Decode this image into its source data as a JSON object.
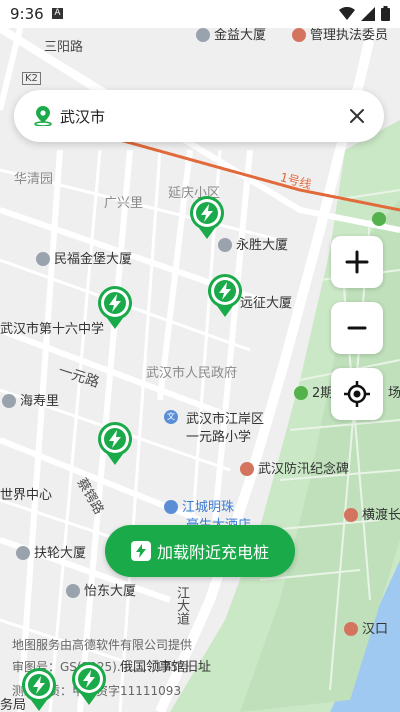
{
  "status_bar": {
    "time": "9:36",
    "notification_glyph": "A"
  },
  "search": {
    "city": "武汉市"
  },
  "map_controls": {
    "zoom_in": "+",
    "zoom_out": "−"
  },
  "load_button": {
    "label": "加载附近充电桩"
  },
  "map_labels": {
    "sanyang_road": "三阳路",
    "jinyi_building": "金益大厦",
    "admin_office": "管理执法委员",
    "k2": "K2",
    "huaqingyuan": "华清园",
    "guangxingli": "广兴里",
    "yanqing_area": "延庆小区",
    "line1": "1号线",
    "minfu_building": "民福金堡大厦",
    "yongsheng_building": "永胜大厦",
    "yuanzheng_building": "远征大厦",
    "school16": "武汉市第十六中学",
    "yiyuan_road": "一元路",
    "gov": "武汉市人民政府",
    "haishouli": "海寿里",
    "jiangan_school_1": "武汉市江岸区",
    "jiangan_school_2": "一元路小学",
    "flood_memorial": "武汉防汛纪念碑",
    "world_center": "世界中心",
    "caie_road": "蔡锷路",
    "jiangcheng_hotel_1": "江城明珠",
    "jiangcheng_hotel_2": "豪生大酒店",
    "hengdu": "横渡长",
    "fulun_building": "扶轮大厦",
    "yidong_building": "怡东大厦",
    "dajie": "江大道",
    "hankou": "汉口",
    "consulate": "俄国领事馆旧址",
    "bureau": "务局",
    "park_label": "2期",
    "park_label2": "场",
    "letter_wen": "文"
  },
  "attribution": {
    "line1": "地图服务由高德软件有限公司提供",
    "line2": "审图号：GS(2025)..........175号",
    "line3": "测绘资质：甲测资字11111093"
  },
  "colors": {
    "accent": "#1aaa4a",
    "marker": "#1aaa4a",
    "metro": "#e2693a",
    "park": "#c8e6c9"
  },
  "markers": [
    "charging-station",
    "charging-station",
    "charging-station",
    "charging-station",
    "charging-station",
    "charging-station",
    "charging-station"
  ]
}
